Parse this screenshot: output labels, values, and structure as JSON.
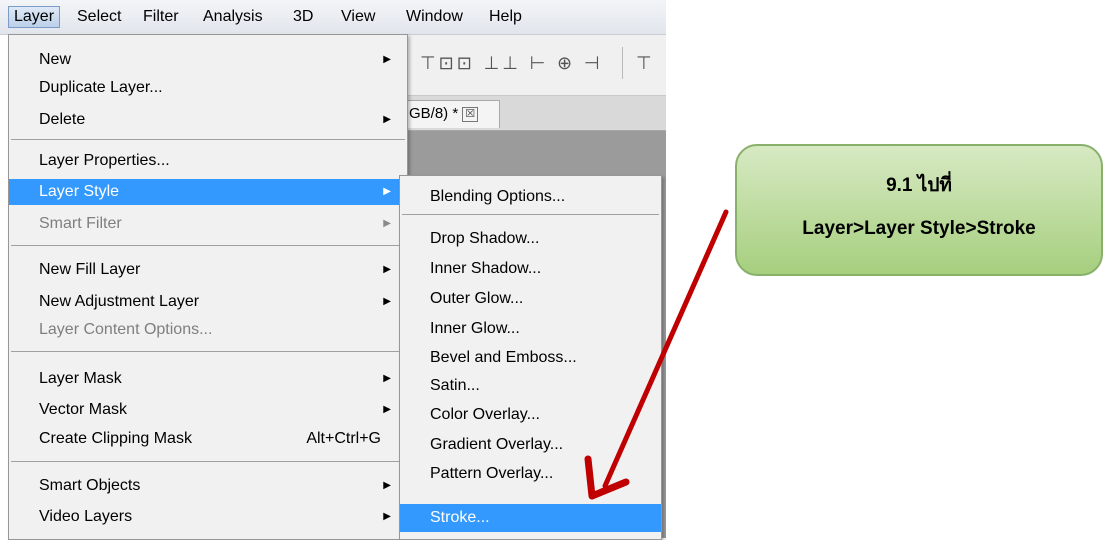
{
  "menubar": {
    "items": [
      "Layer",
      "Select",
      "Filter",
      "Analysis",
      "3D",
      "View",
      "Window",
      "Help"
    ]
  },
  "document_tab": {
    "label": "GB/8) *",
    "close_glyph": "☒"
  },
  "toolbar": {
    "icons_text": "⊤⊡⊡ ⊥⊥ ⊢ ⊕ ⊣",
    "end_icon": "⊤"
  },
  "layer_menu": {
    "items": [
      {
        "label": "New",
        "submenu": true
      },
      {
        "label": "Duplicate Layer..."
      },
      {
        "label": "Delete",
        "submenu": true
      },
      {
        "label": "Layer Properties..."
      },
      {
        "label": "Layer Style",
        "submenu": true,
        "highlighted": true
      },
      {
        "label": "Smart Filter",
        "submenu": true,
        "disabled": true
      },
      {
        "label": "New Fill Layer",
        "submenu": true
      },
      {
        "label": "New Adjustment Layer",
        "submenu": true
      },
      {
        "label": "Layer Content Options...",
        "disabled": true
      },
      {
        "label": "Layer Mask",
        "submenu": true
      },
      {
        "label": "Vector Mask",
        "submenu": true
      },
      {
        "label": "Create Clipping Mask",
        "shortcut": "Alt+Ctrl+G"
      },
      {
        "label": "Smart Objects",
        "submenu": true
      },
      {
        "label": "Video Layers",
        "submenu": true
      }
    ]
  },
  "layer_style_submenu": {
    "items": [
      {
        "label": "Blending Options..."
      },
      {
        "label": "Drop Shadow..."
      },
      {
        "label": "Inner Shadow..."
      },
      {
        "label": "Outer Glow..."
      },
      {
        "label": "Inner Glow..."
      },
      {
        "label": "Bevel and Emboss..."
      },
      {
        "label": "Satin..."
      },
      {
        "label": "Color Overlay..."
      },
      {
        "label": "Gradient Overlay..."
      },
      {
        "label": "Pattern Overlay..."
      },
      {
        "label": "Stroke...",
        "highlighted": true
      }
    ]
  },
  "callout": {
    "line1": "9.1 ไปที่",
    "line2": "Layer>Layer Style>Stroke"
  },
  "colors": {
    "highlight": "#3399ff",
    "callout_fill": "#b9db95",
    "arrow": "#c00000"
  }
}
